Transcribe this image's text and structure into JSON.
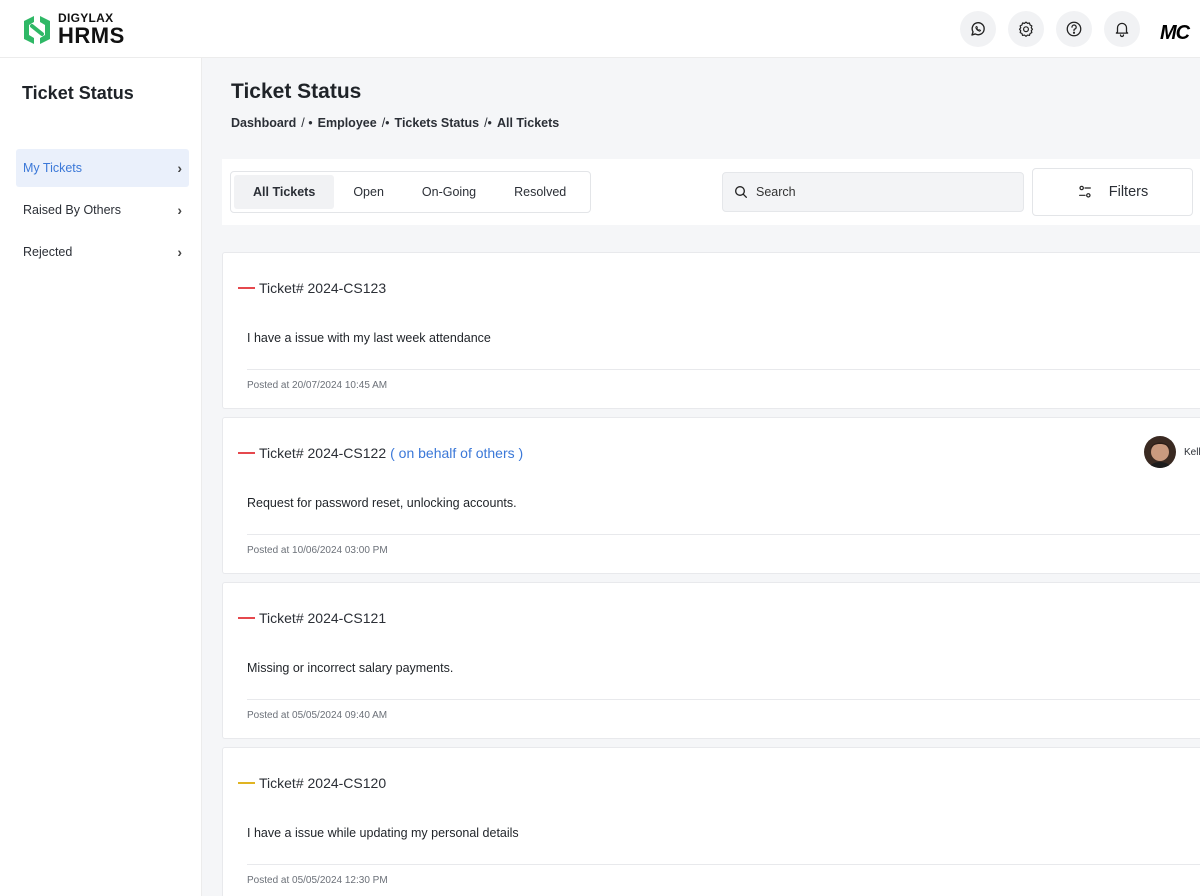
{
  "brand": {
    "name_top": "DIGYLAX",
    "name_main": "HRMS",
    "partner_mark": "MC"
  },
  "header_icons": [
    "whatsapp-icon",
    "gear-icon",
    "help-icon",
    "bell-icon"
  ],
  "sidebar": {
    "title": "Ticket Status",
    "items": [
      {
        "label": "My Tickets",
        "active": true
      },
      {
        "label": "Raised By Others",
        "active": false
      },
      {
        "label": "Rejected",
        "active": false
      }
    ]
  },
  "page": {
    "title": "Ticket Status",
    "breadcrumb": [
      "Dashboard",
      "Employee",
      "Tickets Status",
      "All Tickets"
    ],
    "breadcrumb_seps": [
      "/ •",
      "/•",
      "/•"
    ]
  },
  "toolbar": {
    "tabs": [
      "All Tickets",
      "Open",
      "On-Going",
      "Resolved"
    ],
    "active_tab": "All Tickets",
    "search_placeholder": "Search",
    "filters_label": "Filters"
  },
  "tickets": [
    {
      "id": "Ticket# 2024-CS123",
      "behalf": "",
      "description": "I have a issue with my last week attendance",
      "posted": "Posted at 20/07/2024 10:45 AM",
      "priority_color": "#e5484d",
      "assignee": ""
    },
    {
      "id": "Ticket# 2024-CS122",
      "behalf": "( on behalf of others )",
      "description": "Request for password reset, unlocking accounts.",
      "posted": "Posted at 10/06/2024 03:00 PM",
      "priority_color": "#e5484d",
      "assignee": "Kell"
    },
    {
      "id": "Ticket# 2024-CS121",
      "behalf": "",
      "description": "Missing or incorrect salary payments.",
      "posted": "Posted at 05/05/2024 09:40 AM",
      "priority_color": "#e5484d",
      "assignee": ""
    },
    {
      "id": "Ticket# 2024-CS120",
      "behalf": "",
      "description": "I have a issue while updating my personal details",
      "posted": "Posted at 05/05/2024 12:30 PM",
      "priority_color": "#e0b422",
      "assignee": ""
    }
  ],
  "colors": {
    "accent": "#3b78d8",
    "brand_green": "#2fb866",
    "priority_high": "#e5484d",
    "priority_medium": "#e0b422"
  }
}
